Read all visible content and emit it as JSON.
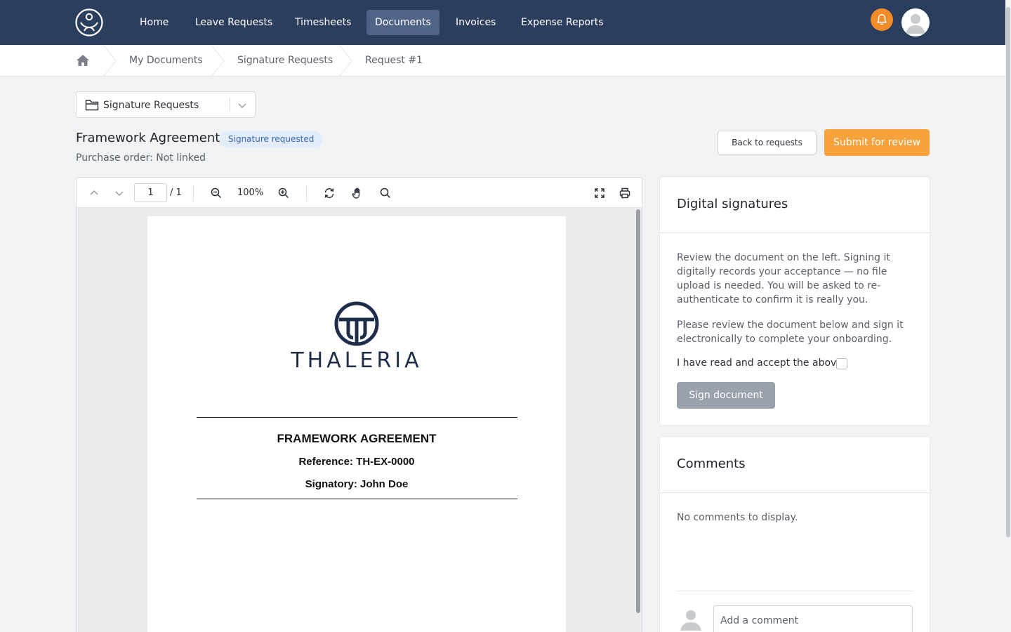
{
  "nav": {
    "items": [
      {
        "label": "Home",
        "active": false
      },
      {
        "label": "Leave Requests",
        "active": false
      },
      {
        "label": "Timesheets",
        "active": false
      },
      {
        "label": "Documents",
        "active": true
      },
      {
        "label": "Invoices",
        "active": false
      },
      {
        "label": "Expense Reports",
        "active": false
      }
    ],
    "icons": {
      "logo": "company-logo-icon",
      "notifications": "bell-icon",
      "user": "user-avatar"
    },
    "colors": {
      "bar": "#2c3e5d",
      "active_item": "#4f6486",
      "bell": "#f28c28"
    }
  },
  "breadcrumb": {
    "home_icon": "home-icon",
    "items": [
      "My Documents",
      "Signature Requests",
      "Request #1"
    ]
  },
  "folder_select": {
    "icon": "folder-icon",
    "value": "Signature Requests"
  },
  "document": {
    "title": "Framework Agreement",
    "status": "Signature requested",
    "purchase_order": "Purchase order: Not linked"
  },
  "actions": {
    "back_label": "Back to requests",
    "submit_label": "Submit for review",
    "submit_color": "#f7a23b"
  },
  "viewer": {
    "page_current": "1",
    "page_total": "/ 1",
    "zoom": "100%",
    "page": {
      "brand": "THALERIA",
      "heading": "FRAMEWORK AGREEMENT",
      "reference": "Reference: TH-EX-0000",
      "signatory": "Signatory: John Doe"
    }
  },
  "signatures": {
    "title": "Digital signatures",
    "intro": "Review the document on the left. Signing it digitally records your acceptance — no file upload is needed. You will be asked to re-authenticate to confirm it is really you.",
    "instruction": "Please review the document below and sign it electronically to complete your onboarding.",
    "accept_label": "I have read and accept the above.",
    "accepted": false,
    "sign_label": "Sign document"
  },
  "comments": {
    "title": "Comments",
    "empty": "No comments to display.",
    "placeholder": "Add a comment"
  }
}
